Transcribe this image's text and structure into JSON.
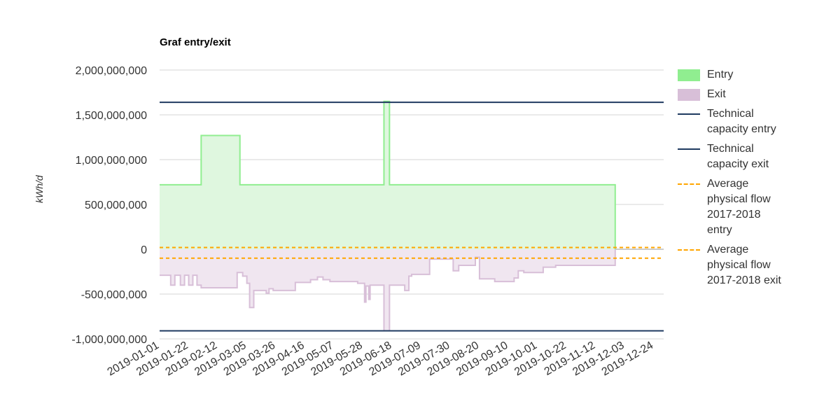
{
  "chart_data": {
    "type": "area",
    "title": "Graf entry/exit",
    "ylabel": "kWh/d",
    "xlabel": "",
    "ylim": [
      -1000000000,
      2000000000
    ],
    "yticks": [
      2000000000,
      1500000000,
      1000000000,
      500000000,
      0,
      -500000000,
      -1000000000
    ],
    "ytick_labels": [
      "2,000,000,000",
      "1,500,000,000",
      "1,000,000,000",
      "500,000,000",
      "0",
      "-500,000,000",
      "-1,000,000,000"
    ],
    "x_range": [
      "2019-01-01",
      "2019-12-31"
    ],
    "xtick_labels": [
      "2019-01-01",
      "2019-01-22",
      "2019-02-12",
      "2019-03-05",
      "2019-03-26",
      "2019-04-16",
      "2019-05-07",
      "2019-05-28",
      "2019-06-18",
      "2019-07-09",
      "2019-07-30",
      "2019-08-20",
      "2019-09-10",
      "2019-10-01",
      "2019-10-22",
      "2019-11-12",
      "2019-12-03",
      "2019-12-24"
    ],
    "grid": true,
    "legend_position": "right",
    "series": [
      {
        "name": "Entry",
        "kind": "area",
        "color": "#90ee90",
        "fill": "#dff7df",
        "points": [
          [
            "2019-01-01",
            720000000
          ],
          [
            "2019-01-31",
            720000000
          ],
          [
            "2019-01-31",
            1270000000
          ],
          [
            "2019-02-28",
            1270000000
          ],
          [
            "2019-02-28",
            720000000
          ],
          [
            "2019-06-12",
            720000000
          ],
          [
            "2019-06-12",
            1650000000
          ],
          [
            "2019-06-16",
            1650000000
          ],
          [
            "2019-06-16",
            720000000
          ],
          [
            "2019-11-26",
            720000000
          ],
          [
            "2019-11-26",
            0
          ]
        ]
      },
      {
        "name": "Exit",
        "kind": "area",
        "color": "#d8bfd8",
        "fill": "#f0e6f0",
        "points": [
          [
            "2019-01-01",
            -290000000
          ],
          [
            "2019-01-09",
            -290000000
          ],
          [
            "2019-01-09",
            -400000000
          ],
          [
            "2019-01-12",
            -400000000
          ],
          [
            "2019-01-12",
            -290000000
          ],
          [
            "2019-01-16",
            -290000000
          ],
          [
            "2019-01-16",
            -400000000
          ],
          [
            "2019-01-19",
            -400000000
          ],
          [
            "2019-01-19",
            -290000000
          ],
          [
            "2019-01-22",
            -290000000
          ],
          [
            "2019-01-22",
            -400000000
          ],
          [
            "2019-01-25",
            -400000000
          ],
          [
            "2019-01-25",
            -290000000
          ],
          [
            "2019-01-28",
            -290000000
          ],
          [
            "2019-01-28",
            -400000000
          ],
          [
            "2019-01-31",
            -400000000
          ],
          [
            "2019-01-31",
            -430000000
          ],
          [
            "2019-02-26",
            -430000000
          ],
          [
            "2019-02-26",
            -260000000
          ],
          [
            "2019-03-02",
            -260000000
          ],
          [
            "2019-03-02",
            -300000000
          ],
          [
            "2019-03-05",
            -300000000
          ],
          [
            "2019-03-05",
            -380000000
          ],
          [
            "2019-03-07",
            -380000000
          ],
          [
            "2019-03-07",
            -650000000
          ],
          [
            "2019-03-10",
            -650000000
          ],
          [
            "2019-03-10",
            -460000000
          ],
          [
            "2019-03-19",
            -460000000
          ],
          [
            "2019-03-19",
            -490000000
          ],
          [
            "2019-03-21",
            -490000000
          ],
          [
            "2019-03-21",
            -440000000
          ],
          [
            "2019-03-24",
            -440000000
          ],
          [
            "2019-03-24",
            -460000000
          ],
          [
            "2019-04-09",
            -460000000
          ],
          [
            "2019-04-09",
            -370000000
          ],
          [
            "2019-04-20",
            -370000000
          ],
          [
            "2019-04-20",
            -340000000
          ],
          [
            "2019-04-25",
            -340000000
          ],
          [
            "2019-04-25",
            -310000000
          ],
          [
            "2019-04-29",
            -310000000
          ],
          [
            "2019-04-29",
            -340000000
          ],
          [
            "2019-05-04",
            -340000000
          ],
          [
            "2019-05-04",
            -360000000
          ],
          [
            "2019-05-24",
            -360000000
          ],
          [
            "2019-05-24",
            -380000000
          ],
          [
            "2019-05-29",
            -380000000
          ],
          [
            "2019-05-29",
            -590000000
          ],
          [
            "2019-05-30",
            -590000000
          ],
          [
            "2019-05-30",
            -410000000
          ],
          [
            "2019-06-01",
            -410000000
          ],
          [
            "2019-06-01",
            -560000000
          ],
          [
            "2019-06-02",
            -560000000
          ],
          [
            "2019-06-02",
            -400000000
          ],
          [
            "2019-06-12",
            -400000000
          ],
          [
            "2019-06-12",
            -910000000
          ],
          [
            "2019-06-16",
            -910000000
          ],
          [
            "2019-06-16",
            -400000000
          ],
          [
            "2019-06-27",
            -400000000
          ],
          [
            "2019-06-27",
            -460000000
          ],
          [
            "2019-06-30",
            -460000000
          ],
          [
            "2019-06-30",
            -300000000
          ],
          [
            "2019-07-02",
            -300000000
          ],
          [
            "2019-07-02",
            -280000000
          ],
          [
            "2019-07-15",
            -280000000
          ],
          [
            "2019-07-15",
            -110000000
          ],
          [
            "2019-08-01",
            -110000000
          ],
          [
            "2019-08-01",
            -240000000
          ],
          [
            "2019-08-05",
            -240000000
          ],
          [
            "2019-08-05",
            -180000000
          ],
          [
            "2019-08-17",
            -180000000
          ],
          [
            "2019-08-17",
            -90000000
          ],
          [
            "2019-08-20",
            -90000000
          ],
          [
            "2019-08-20",
            -330000000
          ],
          [
            "2019-08-31",
            -330000000
          ],
          [
            "2019-08-31",
            -360000000
          ],
          [
            "2019-09-14",
            -360000000
          ],
          [
            "2019-09-14",
            -320000000
          ],
          [
            "2019-09-17",
            -320000000
          ],
          [
            "2019-09-17",
            -240000000
          ],
          [
            "2019-09-21",
            -240000000
          ],
          [
            "2019-09-21",
            -260000000
          ],
          [
            "2019-10-05",
            -260000000
          ],
          [
            "2019-10-05",
            -200000000
          ],
          [
            "2019-10-14",
            -200000000
          ],
          [
            "2019-10-14",
            -180000000
          ],
          [
            "2019-11-26",
            -180000000
          ],
          [
            "2019-11-26",
            0
          ]
        ]
      },
      {
        "name": "Technical capacity entry",
        "kind": "line",
        "color": "#1f3a60",
        "value": 1640000000
      },
      {
        "name": "Technical capacity exit",
        "kind": "line",
        "color": "#1f3a60",
        "value": -910000000
      },
      {
        "name": "Average physical flow 2017-2018 entry",
        "kind": "dashed",
        "color": "#ffa500",
        "value": 20000000
      },
      {
        "name": "Average physical flow 2017-2018 exit",
        "kind": "dashed",
        "color": "#ffa500",
        "value": -100000000
      }
    ]
  },
  "legend": {
    "items": [
      {
        "label": "Entry",
        "kind": "box",
        "color": "#90ee90"
      },
      {
        "label": "Exit",
        "kind": "box",
        "color": "#d8bfd8"
      },
      {
        "label": "Technical capacity entry",
        "kind": "line",
        "color": "#1f3a60"
      },
      {
        "label": "Technical capacity exit",
        "kind": "line",
        "color": "#1f3a60"
      },
      {
        "label": "Average physical flow 2017-2018 entry",
        "kind": "dashed",
        "color": "#ffa500"
      },
      {
        "label": "Average physical flow 2017-2018 exit",
        "kind": "dashed",
        "color": "#ffa500"
      }
    ]
  }
}
